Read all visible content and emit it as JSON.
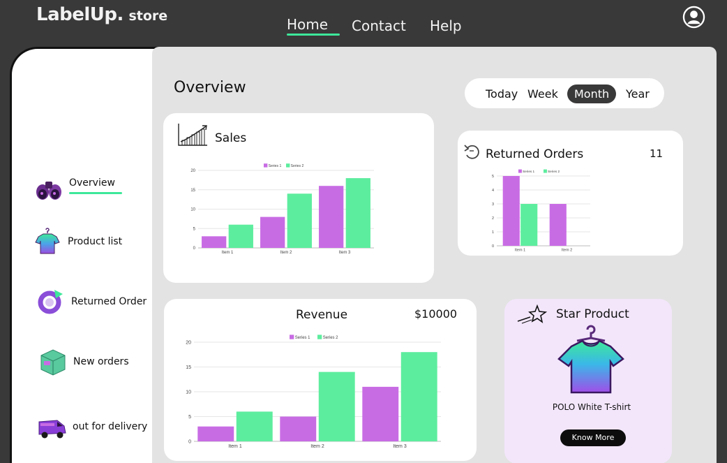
{
  "brand": {
    "main": "LabelUp.",
    "sub": "store"
  },
  "nav": {
    "items": [
      {
        "label": "Home"
      },
      {
        "label": "Contact"
      },
      {
        "label": "Help"
      }
    ]
  },
  "sidebar": {
    "items": [
      {
        "label": "Overview",
        "icon": "binoculars-icon"
      },
      {
        "label": "Product list",
        "icon": "tshirt-icon"
      },
      {
        "label": "Returned Order",
        "icon": "return-arrow-icon"
      },
      {
        "label": "New orders",
        "icon": "box-icon"
      },
      {
        "label": "out for delivery",
        "icon": "van-icon"
      }
    ]
  },
  "overview": {
    "title": "Overview"
  },
  "period": {
    "options": [
      "Today",
      "Week",
      "Month",
      "Year"
    ],
    "selected": "Month"
  },
  "sales": {
    "title": "Sales"
  },
  "returned": {
    "title": "Returned Orders",
    "count": "11"
  },
  "revenue": {
    "title": "Revenue",
    "amount": "$10000"
  },
  "star": {
    "title": "Star Product",
    "product_name": "POLO White T-shirt",
    "button": "Know More"
  },
  "colors": {
    "series1": "#c86ce4",
    "series2": "#5ded9e",
    "accent": "#3ee89a",
    "dark": "#3a3939"
  },
  "chart_data": [
    {
      "type": "bar",
      "name": "sales-chart",
      "categories": [
        "Item 1",
        "Item 2",
        "Item 3"
      ],
      "series": [
        {
          "name": "Series 1",
          "values": [
            3,
            8,
            16
          ]
        },
        {
          "name": "Series 2",
          "values": [
            6,
            14,
            18
          ]
        }
      ],
      "yticks": [
        0,
        5,
        10,
        15,
        20
      ],
      "ylim": [
        0,
        20
      ],
      "legend": "top"
    },
    {
      "type": "bar",
      "name": "returned-chart",
      "categories": [
        "Item 1",
        "Item 2"
      ],
      "series": [
        {
          "name": "Series 1",
          "values": [
            5,
            3
          ]
        },
        {
          "name": "Series 2",
          "values": [
            3,
            0
          ]
        }
      ],
      "yticks": [
        0,
        1,
        2,
        3,
        4,
        5
      ],
      "ylim": [
        0,
        5
      ],
      "legend": "top"
    },
    {
      "type": "bar",
      "name": "revenue-chart",
      "categories": [
        "Item 1",
        "Item 2",
        "Item 3"
      ],
      "series": [
        {
          "name": "Series 1",
          "values": [
            3,
            5,
            11
          ]
        },
        {
          "name": "Series 2",
          "values": [
            6,
            14,
            18
          ]
        }
      ],
      "yticks": [
        0,
        5,
        10,
        15,
        20
      ],
      "ylim": [
        0,
        20
      ],
      "legend": "top"
    }
  ]
}
